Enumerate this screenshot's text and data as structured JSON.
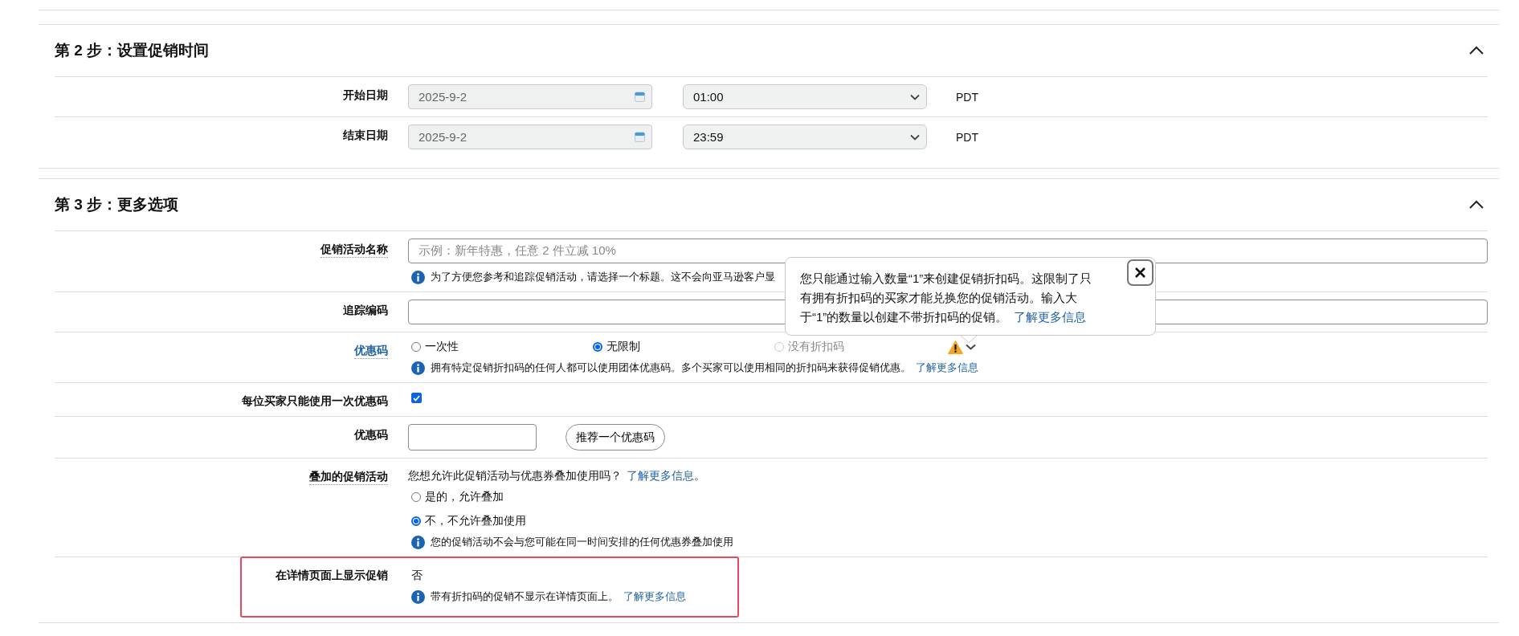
{
  "sections": [
    {
      "title": "第 2 步：设置促销时间",
      "expanded": true,
      "rows": [
        {
          "kind": "datetime",
          "label": "开始日期",
          "label_dotted": false,
          "label_link": false,
          "date": "2025-9-2",
          "time": "01:00",
          "timezone": "PDT"
        },
        {
          "kind": "datetime",
          "label": "结束日期",
          "label_dotted": false,
          "label_link": false,
          "date": "2025-9-2",
          "time": "23:59",
          "timezone": "PDT"
        }
      ]
    },
    {
      "title": "第 3 步：更多选项",
      "expanded": true,
      "rows": [
        {
          "kind": "text",
          "label": "促销活动名称",
          "label_dotted": true,
          "label_link": false,
          "placeholder": "示例：新年特惠，任意 2 件立减 10%",
          "help": "为了方便您参考和追踪促销活动，请选择一个标题。这不会向亚马逊客户显"
        },
        {
          "kind": "text",
          "label": "追踪编码",
          "label_dotted": false,
          "label_link": false
        },
        {
          "kind": "radio",
          "label": "优惠码",
          "label_dotted": true,
          "label_link": true,
          "options": [
            {
              "label": "一次性",
              "selected": false,
              "disabled": false
            },
            {
              "label": "无限制",
              "selected": true,
              "disabled": false
            },
            {
              "label": "没有折扣码",
              "selected": false,
              "disabled": true
            }
          ],
          "warning": true,
          "help": "拥有特定促销折扣码的任何人都可以使用团体优惠码。多个买家可以使用相同的折扣码来获得促销优惠。",
          "help_link": "了解更多信息"
        },
        {
          "kind": "checkbox",
          "label": "每位买家只能使用一次优惠码",
          "label_dotted": false,
          "label_link": false,
          "checked": true
        },
        {
          "kind": "code",
          "label": "优惠码",
          "label_dotted": false,
          "label_link": false,
          "button": "推荐一个优惠码"
        },
        {
          "kind": "stacking",
          "label": "叠加的促销活动",
          "label_dotted": true,
          "label_link": false,
          "question": "您想允许此促销活动与优惠券叠加使用吗？",
          "link": "了解更多信息",
          "suffix": "。",
          "options": [
            {
              "label": "是的，允许叠加",
              "selected": false,
              "disabled": false
            },
            {
              "label": "不，不允许叠加使用",
              "selected": true,
              "disabled": false
            }
          ],
          "help": "您的促销活动不会与您可能在同一时间安排的任何优惠券叠加使用"
        },
        {
          "kind": "display",
          "label": "在详情页面上显示促销",
          "label_dotted": false,
          "label_link": false,
          "value": "否",
          "help": "带有折扣码的促销不显示在详情页面上。",
          "help_link": "了解更多信息",
          "highlighted": true
        }
      ]
    }
  ],
  "tooltip": {
    "text": "您只能通过输入数量“1”来创建促销折扣码。这限制了只有拥有折扣码的买家才能兑换您的促销活动。输入大于“1”的数量以创建不带折扣码的促销。",
    "link": "了解更多信息"
  }
}
